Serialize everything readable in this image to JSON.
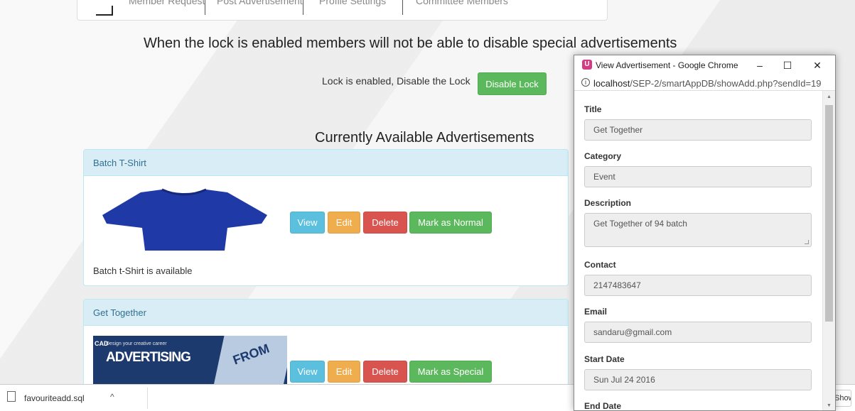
{
  "nav": {
    "tabs": [
      "Member Request",
      "Post Advertisement",
      "Profile Settings",
      "Committee Members"
    ]
  },
  "lock": {
    "heading": "When the lock is enabled members will not be able to disable special advertisements",
    "status_text": "Lock is enabled, Disable the Lock",
    "button_label": "Disable Lock"
  },
  "ads": {
    "heading": "Currently Available Advertisements",
    "items": [
      {
        "title": "Batch T-Shirt",
        "description": "Batch t-Shirt is available",
        "view_label": "View",
        "edit_label": "Edit",
        "delete_label": "Delete",
        "mark_label": "Mark as Normal"
      },
      {
        "title": "Get Together",
        "image_text_small": "Design your creative career",
        "image_text_big": "ADVERTISING",
        "image_text_side": "CAD",
        "image_text_poster": "FROM",
        "view_label": "View",
        "edit_label": "Edit",
        "delete_label": "Delete",
        "mark_label": "Mark as Special"
      }
    ]
  },
  "popup": {
    "window_title": "View Advertisement - Google Chrome",
    "app_icon_letter": "U",
    "url_host": "localhost",
    "url_path": "/SEP-2/smartAppDB/showAdd.php?sendId=19",
    "minimize": "–",
    "maximize": "☐",
    "close": "✕",
    "fields": {
      "title_label": "Title",
      "title_value": "Get Together",
      "category_label": "Category",
      "category_value": "Event",
      "description_label": "Description",
      "description_value": "Get Together of 94 batch",
      "contact_label": "Contact",
      "contact_value": "2147483647",
      "email_label": "Email",
      "email_value": "sandaru@gmail.com",
      "start_label": "Start Date",
      "start_value": "Sun Jul 24 2016",
      "end_label": "End Date"
    }
  },
  "downloads": {
    "file_name": "favouriteadd.sql",
    "chevron": "^",
    "show_all": "Show all"
  },
  "colors": {
    "success": "#5cb85c",
    "info": "#5bc0de",
    "warning": "#f0ad4e",
    "danger": "#d9534f",
    "tshirt": "#1f3aa6"
  }
}
